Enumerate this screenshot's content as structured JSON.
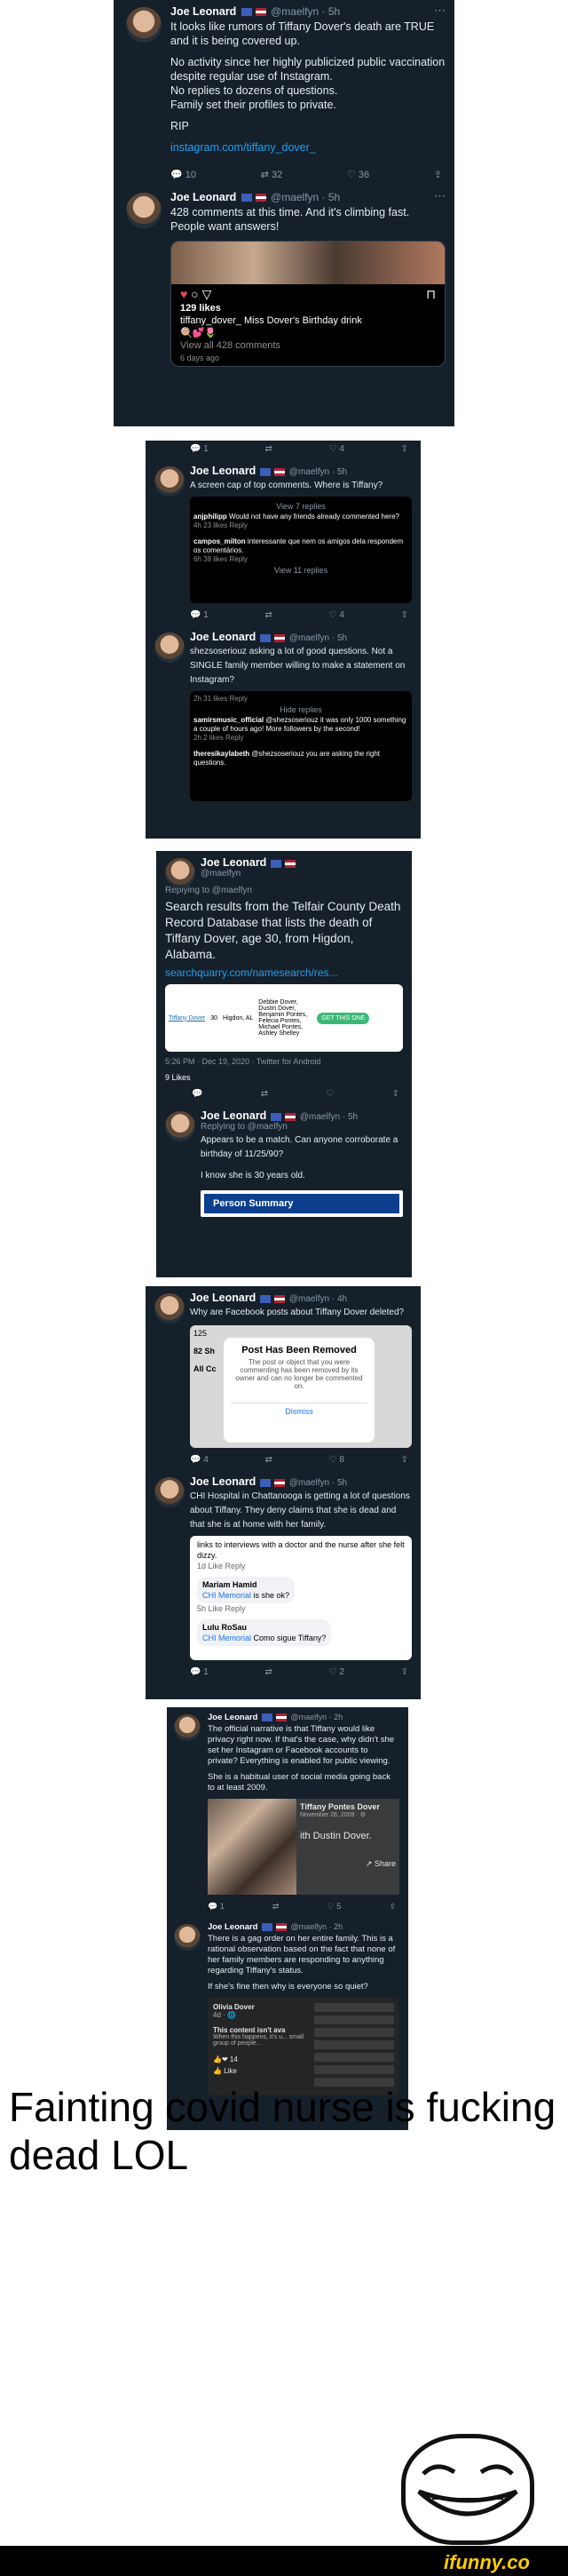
{
  "p1": {
    "t1": {
      "name": "Joe Leonard",
      "handle": "@maelfyn · 5h",
      "lines": [
        "It looks like rumors of Tiffany Dover's death are TRUE and it is being covered up.",
        "No activity since her highly publicized public vaccination despite regular use of Instagram.",
        "No replies to dozens of questions.",
        "Family set their profiles to private.",
        "RIP"
      ],
      "link": "instagram.com/tiffany_dover_",
      "replies": "10",
      "rts": "32",
      "likes": "36"
    },
    "t2": {
      "name": "Joe Leonard",
      "handle": "@maelfyn · 5h",
      "text": "428 comments at this time. And it's climbing fast. People want answers!",
      "ig_likes": "129 likes",
      "ig_caption": "tiffany_dover_ Miss Dover's Birthday drink",
      "ig_emoji": "🍭💕🌷",
      "ig_comments": "View all 428 comments",
      "ig_age": "6 days ago"
    }
  },
  "p2": {
    "actions": {
      "r": "1",
      "rt": "",
      "l": "4"
    },
    "t1": {
      "name": "Joe Leonard",
      "handle": "@maelfyn · 5h",
      "text": "A screen cap of top comments. Where is Tiffany?",
      "view7": "View 7 replies",
      "c1_user": "anjphilipp",
      "c1_text": "Would not have any friends already commented here?",
      "c1_meta": "4h  23 likes  Reply",
      "c2_user": "campos_milton",
      "c2_text": "interessante que nem os amigos dela respondem os comentários.",
      "c2_meta": "6h  38 likes  Reply",
      "view11": "View 11 replies",
      "r": "1",
      "rt": "",
      "l": "4"
    },
    "t2": {
      "name": "Joe Leonard",
      "handle": "@maelfyn · 5h",
      "text": "shezsoseriouz asking a lot of good questions. Not a SINGLE family member willing to make a statement on Instagram?",
      "meta": "2h  31 likes  Reply",
      "hide": "Hide replies",
      "c1_user": "samirsmusic_official",
      "c1_text": "@shezsoseriouz it was only 1000 something a couple of hours ago! More followers by the second!",
      "c1_meta": "2h  2 likes  Reply",
      "c2_user": "theresikaylabeth",
      "c2_text": "@shezsoseriouz you are asking the right questions."
    }
  },
  "p3": {
    "t1": {
      "name": "Joe Leonard",
      "handle": "@maelfyn",
      "replying": "Replying to @maelfyn",
      "text": "Search results from the Telfair County Death Record Database that lists the death of Tiffany Dover, age 30, from Higdon, Alabama.",
      "link": "searchquarry.com/namesearch/res...",
      "rec_title": "Tiffany Dover",
      "rec_age": "30",
      "rec_place": "Higdon, AL",
      "rec_names": "Debbie Dover, Dustin Dover, Benjamin Pontes, Felecia Pontes, Michael Pontes, Ashley Shelley",
      "rec_btn": "GET THIS ONE",
      "meta": "5:26 PM · Dec 19, 2020 · Twitter for Android",
      "likes": "9 Likes"
    },
    "t2": {
      "name": "Joe Leonard",
      "handle": "@maelfyn · 5h",
      "replying": "Replying to @maelfyn",
      "text": "Appears to be a match. Can anyone corroborate a birthday of 11/25/90?",
      "text2": "I know she is 30 years old.",
      "btn": "Person Summary"
    }
  },
  "p4": {
    "t1": {
      "name": "Joe Leonard",
      "handle": "@maelfyn · 4h",
      "text": "Why are Facebook posts about Tiffany Dover deleted?",
      "fb_count": "125",
      "fb_side1": "82 Sh",
      "fb_side2": "All Cc",
      "modal_title": "Post Has Been Removed",
      "modal_text": "The post or object that you were commenting has been removed by its owner and can no longer be commented on.",
      "dismiss": "Dismiss",
      "r": "4",
      "l": "8"
    },
    "t2": {
      "name": "Joe Leonard",
      "handle": "@maelfyn · 5h",
      "text": "CHI Hospital in Chattanooga is getting a lot of questions about Tiffany. They deny claims that she is dead and that she is at home with her family.",
      "top": "links to interviews with a doctor and the nurse after she felt dizzy.",
      "top_meta": "1d   Like   Reply",
      "c1_user": "Mariam Hamid",
      "c1_link": "CHI Memorial",
      "c1_text": "is she ok?",
      "c1_meta": "5h   Like   Reply",
      "c2_user": "Lulu RoSau",
      "c2_link": "CHI Memorial",
      "c2_text": "Como sigue Tiffany?",
      "r": "1",
      "l": "2"
    }
  },
  "p5": {
    "t1": {
      "name": "Joe Leonard",
      "handle": "@maelfyn · 2h",
      "text": "The official narrative is that Tiffany would like privacy right now. If that's the case, why didn't she set her Instagram or Facebook accounts to private? Everything is enabled for public viewing.",
      "text2": "She is a habitual user of social media going back to at least 2009.",
      "fb_name": "Tiffany Pontes Dover",
      "fb_date": "November 26, 2009 · ⚙",
      "fb_with": "ith Dustin Dover.",
      "fb_share": "Share",
      "r": "1",
      "l": "5"
    },
    "t2": {
      "name": "Joe Leonard",
      "handle": "@maelfyn · 2h",
      "text": "There is a gag order on her entire family. This is a rational observation based on the fact that none of her family members are responding to anything regarding Tiffany's status.",
      "text2": "If she's fine then why is everyone so quiet?",
      "fb_user": "Olivia Dover",
      "fb_sub": "4d · 🌐",
      "fb_hidden": "This content isn't ava",
      "fb_hidden2": "When this happens, it's u... small group of people...",
      "fb_count": "14",
      "fb_like": "Like"
    }
  },
  "caption": "Fainting covid nurse is fucking dead LOL",
  "logo": "ifunny.co"
}
